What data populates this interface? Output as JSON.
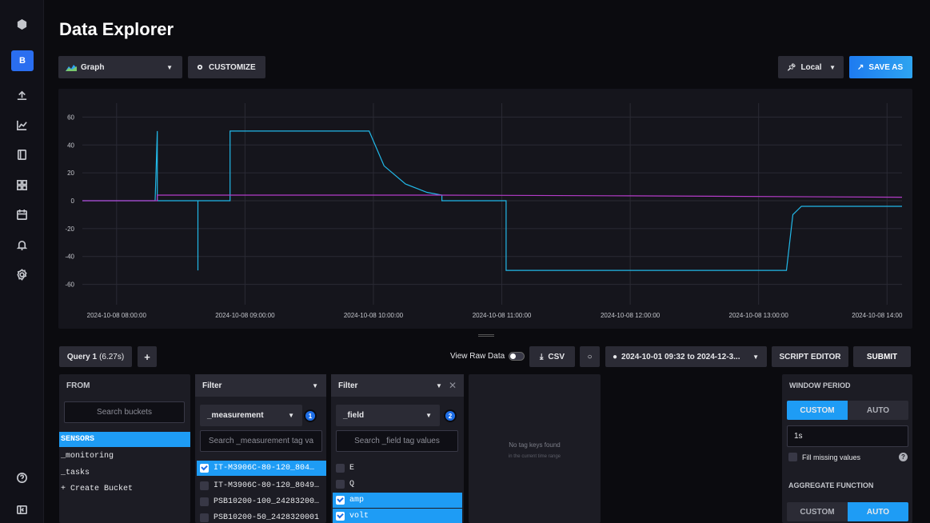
{
  "sidebar": {
    "org_letter": "B",
    "icons": [
      "logo-icon",
      "upload-icon",
      "graph-icon",
      "notebook-icon",
      "dashboard-icon",
      "calendar-icon",
      "bell-icon",
      "gear-icon",
      "help-icon",
      "collapse-icon"
    ]
  },
  "header": {
    "title": "Data Explorer",
    "vis_type": "Graph",
    "customize_label": "CUSTOMIZE",
    "timezone": "Local",
    "save_as_label": "SAVE AS"
  },
  "chart_data": {
    "type": "line",
    "ylim": [
      -70,
      70
    ],
    "yticks": [
      60,
      40,
      20,
      0,
      -20,
      -40,
      -60
    ],
    "xticks": [
      "2024-10-08 08:00:00",
      "2024-10-08 09:00:00",
      "2024-10-08 10:00:00",
      "2024-10-08 11:00:00",
      "2024-10-08 12:00:00",
      "2024-10-08 13:00:00",
      "2024-10-08 14:00"
    ],
    "x_range": [
      "2024-10-08 07:44",
      "2024-10-08 14:07"
    ],
    "series": [
      {
        "color": "#22b8e8",
        "points": [
          [
            "07:44",
            0
          ],
          [
            "08:18",
            0
          ],
          [
            "08:19",
            50
          ],
          [
            "08:19",
            0
          ],
          [
            "08:38",
            0
          ],
          [
            "08:38",
            -50
          ],
          [
            "08:38",
            0
          ],
          [
            "08:53",
            0
          ],
          [
            "08:53",
            50
          ],
          [
            "09:58",
            50
          ],
          [
            "10:05",
            25
          ],
          [
            "10:15",
            12
          ],
          [
            "10:25",
            6
          ],
          [
            "10:32",
            4
          ],
          [
            "10:32",
            0
          ],
          [
            "11:02",
            0
          ],
          [
            "11:02",
            -50
          ],
          [
            "13:13",
            -50
          ],
          [
            "13:16",
            -10
          ],
          [
            "13:20",
            -4
          ],
          [
            "14:07",
            -4
          ]
        ]
      },
      {
        "color": "#b43cc8",
        "points": [
          [
            "07:44",
            0
          ],
          [
            "08:19",
            0
          ],
          [
            "08:19",
            4
          ],
          [
            "10:30",
            4
          ],
          [
            "12:00",
            3.5
          ],
          [
            "14:07",
            2.5
          ]
        ]
      }
    ]
  },
  "query": {
    "tab_label": "Query 1",
    "tab_time": "(6.27s)",
    "add_label": "+",
    "view_raw": "View Raw Data",
    "csv_label": "CSV",
    "time_range": "2024-10-01 09:32 to 2024-12-3...",
    "script_editor": "SCRIPT EDITOR",
    "submit": "SUBMIT"
  },
  "from": {
    "header": "FROM",
    "search_placeholder": "Search buckets",
    "buckets": [
      "SENSORS",
      "_monitoring",
      "_tasks",
      "+ Create Bucket"
    ]
  },
  "filter1": {
    "header": "Filter",
    "key": "_measurement",
    "badge": "1",
    "search_placeholder": "Search _measurement tag va",
    "values": [
      {
        "label": "IT-M3906C-80-120_804…",
        "checked": true
      },
      {
        "label": "IT-M3906C-80-120_8049…",
        "checked": false
      },
      {
        "label": "PSB10200-100_24283200…",
        "checked": false
      },
      {
        "label": "PSB10200-50_2428320001",
        "checked": false
      }
    ]
  },
  "filter2": {
    "header": "Filter",
    "key": "_field",
    "badge": "2",
    "search_placeholder": "Search _field tag values",
    "values": [
      {
        "label": "E",
        "checked": false
      },
      {
        "label": "Q",
        "checked": false
      },
      {
        "label": "amp",
        "checked": true
      },
      {
        "label": "volt",
        "checked": true
      }
    ]
  },
  "empty": {
    "title": "No tag keys found",
    "subtitle": "in the current time range"
  },
  "window": {
    "header": "WINDOW PERIOD",
    "custom": "CUSTOM",
    "auto": "AUTO",
    "value": "1s",
    "fill_missing": "Fill missing values",
    "agg_header": "AGGREGATE FUNCTION",
    "agg_custom": "CUSTOM",
    "agg_auto": "AUTO"
  }
}
